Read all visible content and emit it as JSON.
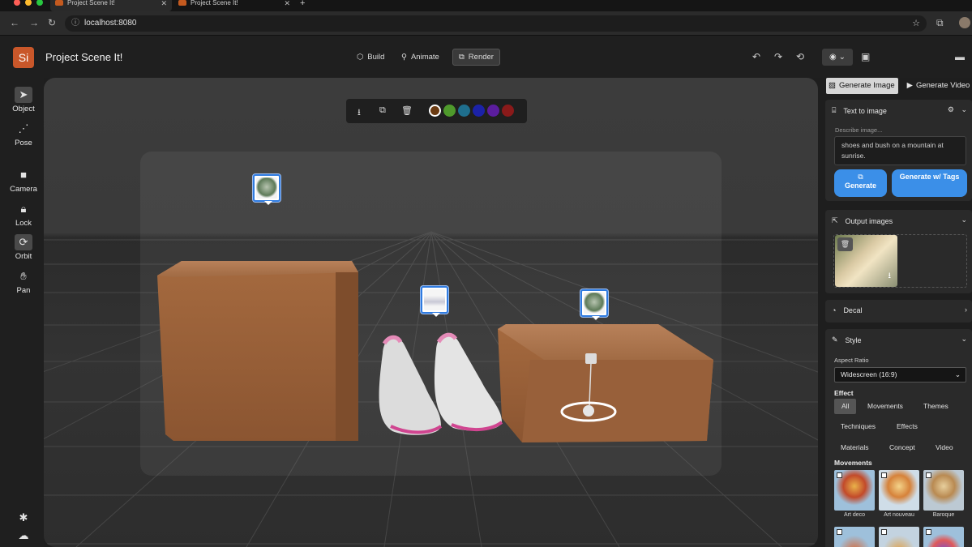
{
  "browser": {
    "tabs": [
      {
        "title": "Project Scene It!",
        "active": true
      },
      {
        "title": "Project Scene It!",
        "active": false
      }
    ],
    "new_tab": "+",
    "url": "localhost:8080"
  },
  "app": {
    "logo": "Si",
    "title": "Project Scene It!",
    "modes": [
      {
        "label": "Build",
        "icon": "cube-icon",
        "active": false
      },
      {
        "label": "Animate",
        "icon": "animate-icon",
        "active": false
      },
      {
        "label": "Render",
        "icon": "render-icon",
        "active": true
      }
    ]
  },
  "left_toolbar": [
    {
      "label": "Object",
      "icon": "cursor-icon",
      "active": true
    },
    {
      "label": "Pose",
      "icon": "pose-icon",
      "active": false
    },
    {
      "label": "Camera",
      "icon": "camera-icon",
      "active": false
    },
    {
      "label": "Lock",
      "icon": "lock-icon",
      "active": false
    },
    {
      "label": "Orbit",
      "icon": "orbit-icon",
      "active": true
    },
    {
      "label": "Pan",
      "icon": "hand-icon",
      "active": false
    }
  ],
  "viewport": {
    "swatch_colors": [
      "#6b3b12",
      "#4f9a2c",
      "#1f6f8e",
      "#1b22a8",
      "#5b1d9e",
      "#8a1a1a"
    ],
    "colors": {
      "box": "#a8683a",
      "floor": "#2f2f2f",
      "selection": "#2f7be0"
    }
  },
  "right_panel": {
    "tabs": [
      {
        "label": "Generate Image",
        "icon": "image-icon",
        "active": true
      },
      {
        "label": "Generate Video",
        "icon": "play-icon",
        "active": false
      }
    ],
    "text_to_image": {
      "title": "Text to image",
      "describe_label": "Describe image...",
      "prompt": "shoes and bush on a mountain at sunrise.",
      "generate_label": "Generate",
      "generate_tags_label": "Generate w/ Tags"
    },
    "output_images": {
      "title": "Output images"
    },
    "decal": {
      "title": "Decal"
    },
    "style": {
      "title": "Style",
      "aspect_label": "Aspect Ratio",
      "aspect_value": "Widescreen (16:9)",
      "effect_label": "Effect",
      "effect_chips": [
        "All",
        "Movements",
        "Themes",
        "Techniques",
        "Effects",
        "Materials",
        "Concept",
        "Video"
      ],
      "movements_label": "Movements",
      "thumbnails": [
        "Art deco",
        "Art nouveau",
        "Baroque"
      ]
    }
  },
  "colors": {
    "accent": "#3b8fe8",
    "brand": "#c9572a"
  }
}
